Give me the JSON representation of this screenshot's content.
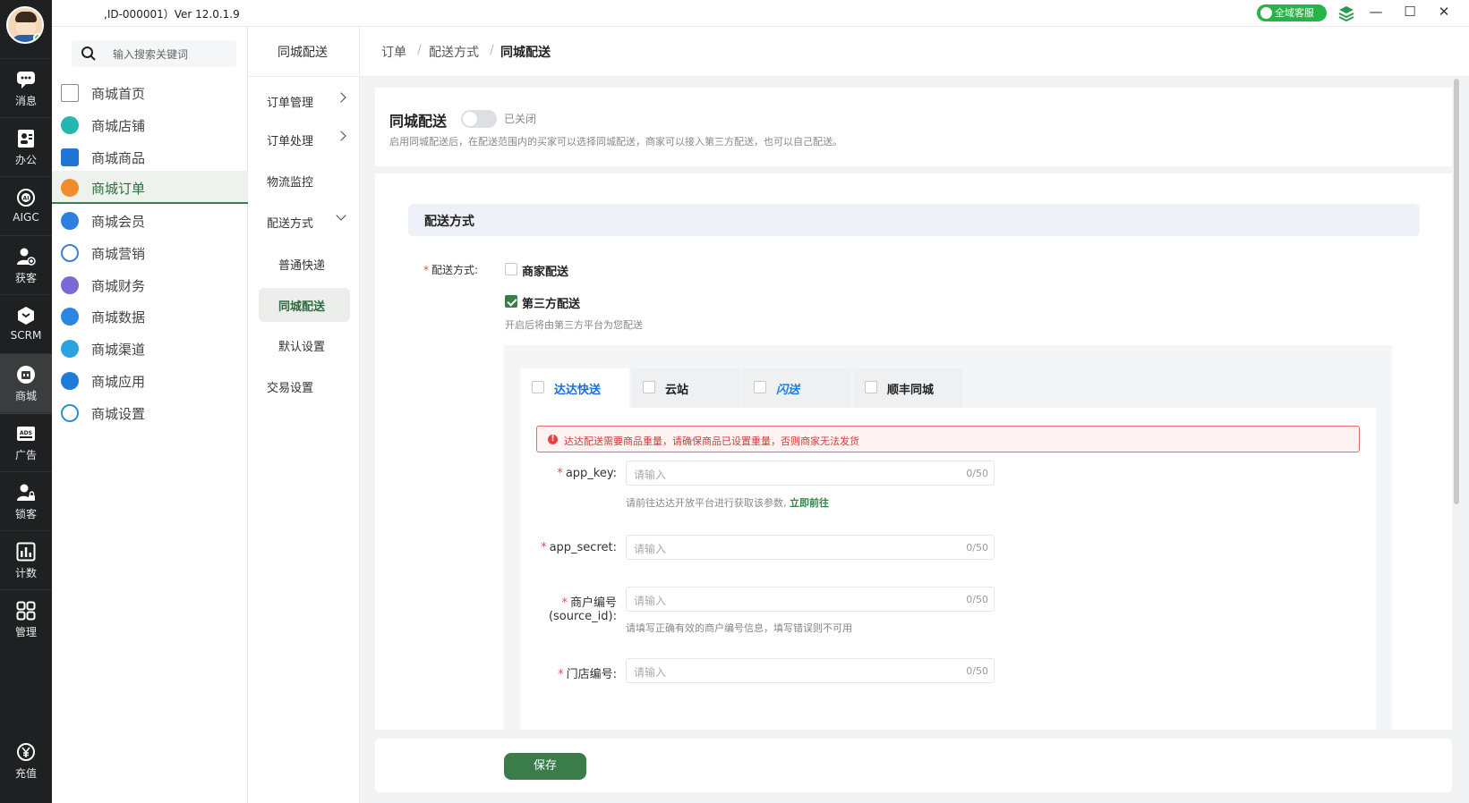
{
  "titlebar": {
    "version": ",ID-000001）Ver 12.0.1.9",
    "service_label": "全域客服",
    "minimize": "—",
    "maximize": "☐",
    "close": "✕"
  },
  "rail": [
    {
      "label": "消息",
      "icon": "chat-icon"
    },
    {
      "label": "办公",
      "icon": "contacts-icon"
    },
    {
      "label": "AIGC",
      "icon": "ai-icon"
    },
    {
      "label": "获客",
      "icon": "user-add-icon"
    },
    {
      "label": "SCRM",
      "icon": "box-icon"
    },
    {
      "label": "商城",
      "icon": "shop-icon"
    },
    {
      "label": "广告",
      "icon": "ads-icon"
    },
    {
      "label": "锁客",
      "icon": "user-lock-icon"
    },
    {
      "label": "计数",
      "icon": "chart-icon"
    },
    {
      "label": "管理",
      "icon": "grid-icon"
    },
    {
      "label": "充值",
      "icon": "yen-icon"
    }
  ],
  "menu": {
    "search_placeholder": "输入搜索关键词",
    "items": [
      {
        "label": "商城首页",
        "color": "#8a8a8a"
      },
      {
        "label": "商城店铺",
        "color": "#25b6b0"
      },
      {
        "label": "商城商品",
        "color": "#1f74d6"
      },
      {
        "label": "商城订单",
        "color": "#f08c2a"
      },
      {
        "label": "商城会员",
        "color": "#2d7ee0"
      },
      {
        "label": "商城营销",
        "color": "#3b7fd8"
      },
      {
        "label": "商城财务",
        "color": "#7b6ad6"
      },
      {
        "label": "商城数据",
        "color": "#2a86e0"
      },
      {
        "label": "商城渠道",
        "color": "#2aa4e0"
      },
      {
        "label": "商城应用",
        "color": "#1f7bd8"
      },
      {
        "label": "商城设置",
        "color": "#2a90d6"
      }
    ]
  },
  "submenu": {
    "header": "同城配送",
    "items": [
      {
        "label": "订单管理"
      },
      {
        "label": "订单处理"
      },
      {
        "label": "物流监控"
      },
      {
        "label": "配送方式"
      },
      {
        "label": "普通快递"
      },
      {
        "label": "同城配送"
      },
      {
        "label": "默认设置"
      },
      {
        "label": "交易设置"
      }
    ]
  },
  "breadcrumb": {
    "c1": "订单",
    "sep": "/",
    "c2": "配送方式",
    "c3": "同城配送"
  },
  "toggle_card": {
    "title": "同城配送",
    "status": "已关闭",
    "description": "启用同城配送后，在配送范围内的买家可以选择同城配送，商家可以接入第三方配送，也可以自己配送。"
  },
  "delivery": {
    "section_title": "配送方式",
    "label": "配送方式:",
    "required": "*",
    "opt_merchant": "商家配送",
    "opt_third": "第三方配送",
    "third_hint": "开启后将由第三方平台为您配送",
    "tabs": [
      {
        "label": "达达快送",
        "color": "#1a6fe0"
      },
      {
        "label": "云站",
        "color": "#1a1a1a"
      },
      {
        "label": "闪送",
        "color": "#1a7ee0"
      },
      {
        "label": "顺丰同城",
        "color": "#222222"
      }
    ],
    "alert": "达达配送需要商品重量，请确保商品已设置重量，否则商家无法发货",
    "alert_icon": "!",
    "fields": {
      "app_key_label": "app_key:",
      "app_key_placeholder": "请输入",
      "app_key_count": "0/50",
      "app_key_hint": "请前往达达开放平台进行获取该参数,",
      "app_key_link": "立即前往",
      "app_secret_label": "app_secret:",
      "app_secret_placeholder": "请输入",
      "app_secret_count": "0/50",
      "merchant_no_label": "商户编号",
      "merchant_no_label2": "(source_id):",
      "merchant_no_placeholder": "请输入",
      "merchant_no_count": "0/50",
      "merchant_no_hint": "请填写正确有效的商户编号信息，填写错误则不可用",
      "store_no_label": "门店编号:",
      "store_no_placeholder": "请输入",
      "store_no_count": "0/50"
    }
  },
  "footer": {
    "save": "保存"
  },
  "colors": {
    "accent": "#3a7d4a",
    "rail_bg": "#1f2021",
    "alert": "#d23c3c"
  }
}
